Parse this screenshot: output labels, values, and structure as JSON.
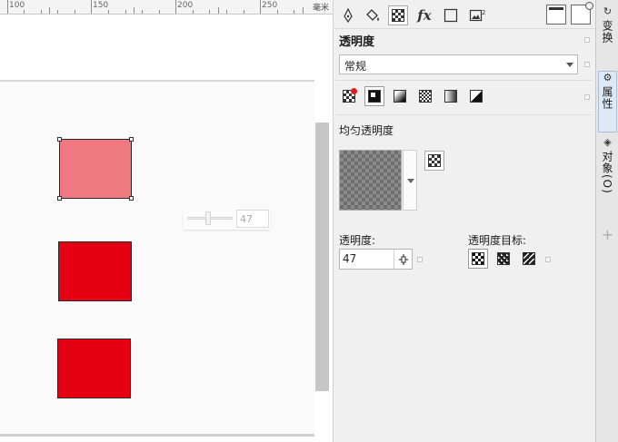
{
  "ruler": {
    "labels": [
      "100",
      "150",
      "200",
      "250"
    ],
    "unit": "毫米"
  },
  "canvas": {
    "shapes": [
      {
        "name": "shape-pink-selected",
        "color": "#F07880"
      },
      {
        "name": "shape-red-2",
        "color": "#E50012"
      },
      {
        "name": "shape-red-3",
        "color": "#E50012"
      }
    ],
    "slider_popup": {
      "value": "47"
    }
  },
  "toolbar": {
    "icons": [
      "pen-icon",
      "fill-icon",
      "transparency-icon",
      "fx-icon",
      "outline-square-icon",
      "image-icon"
    ]
  },
  "panel": {
    "title": "透明度",
    "mode": "常规",
    "section_label": "均匀透明度",
    "transparency_label": "透明度:",
    "transparency_value": "47",
    "target_label": "透明度目标:"
  },
  "sidetabs": {
    "transform": "变换",
    "properties": "属性",
    "objects": "对象(O)"
  },
  "colors": {
    "accent_selected_tab": "#DFE9F5",
    "shape_pink": "#F07880",
    "shape_red": "#E50012"
  }
}
